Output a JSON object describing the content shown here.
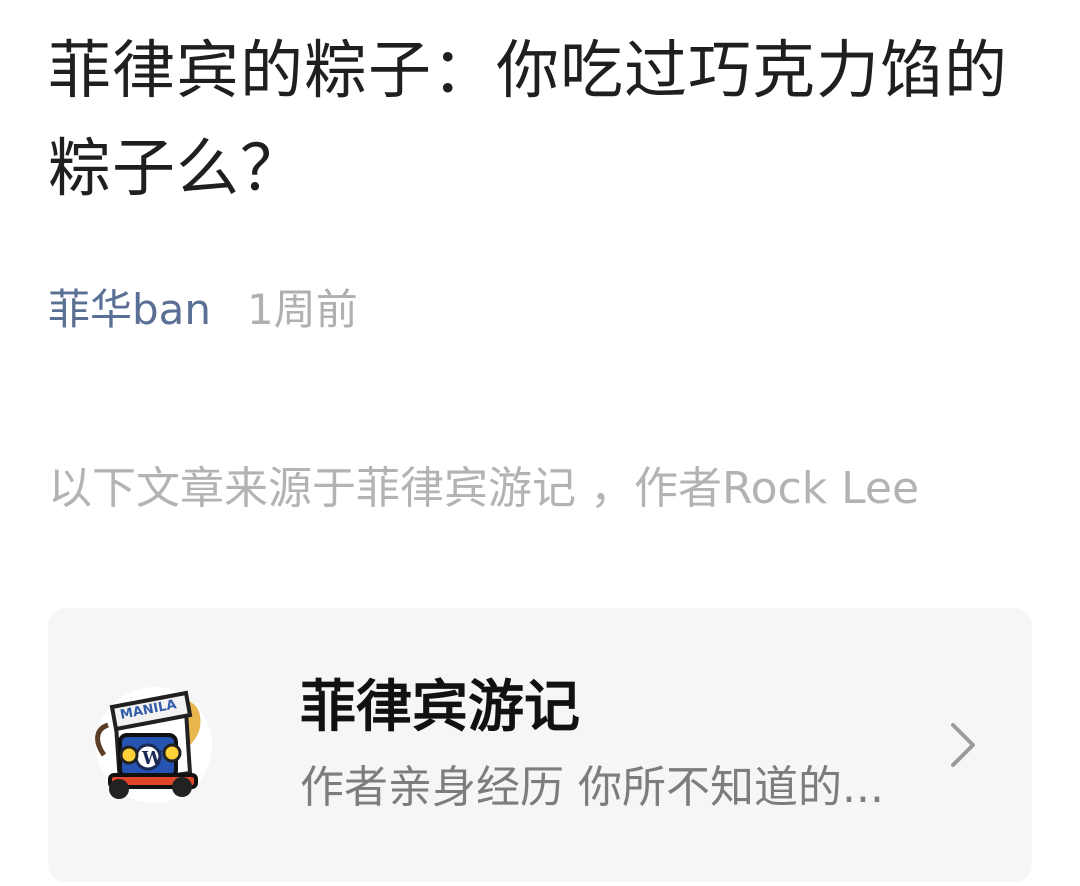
{
  "article": {
    "title": "菲律宾的粽子：你吃过巧克力馅的粽子么？",
    "author": "菲华ban",
    "time": "1周前",
    "source_note": "以下文章来源于菲律宾游记 ，作者Rock Lee"
  },
  "account_card": {
    "name": "菲律宾游记",
    "description": "作者亲身经历 你所不知道的...",
    "avatar_text": "MANILA",
    "icons": {
      "avatar": "jeepney-manila-avatar-icon",
      "chevron": "chevron-right-icon"
    }
  }
}
